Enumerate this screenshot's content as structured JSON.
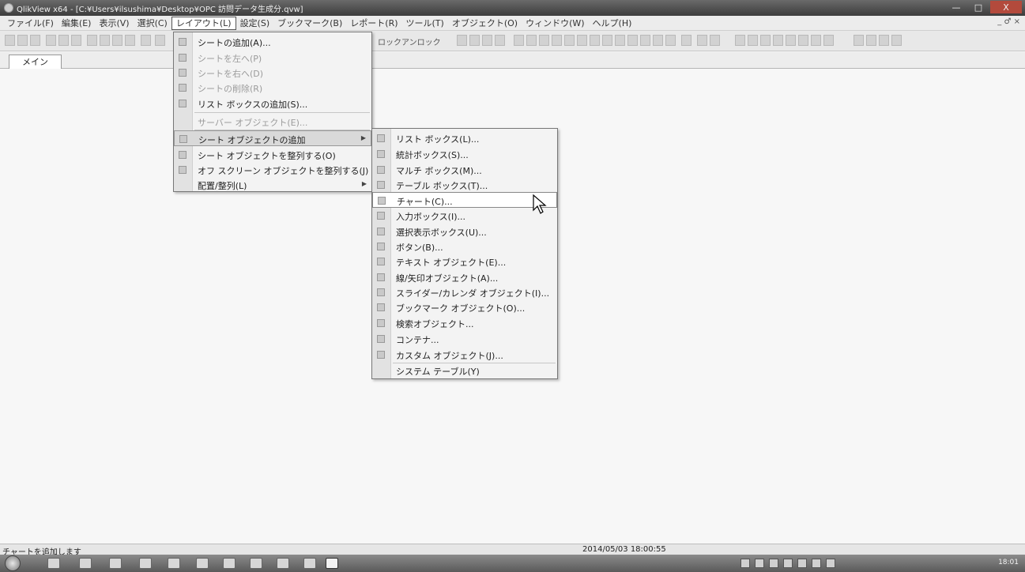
{
  "window": {
    "title": "QlikView x64 - [C:¥Users¥ilsushima¥Desktop¥OPC 訪問データ生成分.qvw]",
    "minimize": "—",
    "maximize": "□",
    "close": "X",
    "mdi_controls": "_ ♂ ×"
  },
  "menubar": {
    "items": [
      "ファイル(F)",
      "編集(E)",
      "表示(V)",
      "選択(C)",
      "レイアウト(L)",
      "設定(S)",
      "ブックマーク(B)",
      "レポート(R)",
      "ツール(T)",
      "オブジェクト(O)",
      "ウィンドウ(W)",
      "ヘルプ(H)"
    ]
  },
  "toolbar": {
    "lock": "ロック",
    "unlock": "アンロック"
  },
  "tabs": {
    "main": "メイン"
  },
  "layout_menu": {
    "items": [
      {
        "label": "シートの追加(A)...",
        "disabled": false
      },
      {
        "label": "シートを左へ(P)",
        "disabled": true
      },
      {
        "label": "シートを右へ(D)",
        "disabled": true
      },
      {
        "label": "シートの削除(R)",
        "disabled": true
      },
      {
        "label": "リスト ボックスの追加(S)...",
        "disabled": false
      },
      {
        "label": "サーバー オブジェクト(E)...",
        "disabled": true
      },
      {
        "label": "シート オブジェクトの追加",
        "disabled": false,
        "submenu": true
      },
      {
        "label": "シート オブジェクトを整列する(O)",
        "disabled": false
      },
      {
        "label": "オフ スクリーン オブジェクトを整列する(J)",
        "disabled": false
      },
      {
        "label": "配置/整列(L)",
        "disabled": false,
        "submenu": true
      }
    ]
  },
  "sheet_object_submenu": {
    "items": [
      "リスト ボックス(L)...",
      "統計ボックス(S)...",
      "マルチ ボックス(M)...",
      "テーブル ボックス(T)...",
      "チャート(C)...",
      "入力ボックス(I)...",
      "選択表示ボックス(U)...",
      "ボタン(B)...",
      "テキスト オブジェクト(E)...",
      "線/矢印オブジェクト(A)...",
      "スライダー/カレンダ オブジェクト(I)...",
      "ブックマーク オブジェクト(O)...",
      "検索オブジェクト...",
      "コンテナ...",
      "カスタム オブジェクト(J)...",
      "システム テーブル(Y)"
    ]
  },
  "status": {
    "message": "チャートを追加します",
    "datetime": "2014/05/03 18:00:55"
  },
  "taskbar": {
    "clock": "18:01"
  }
}
